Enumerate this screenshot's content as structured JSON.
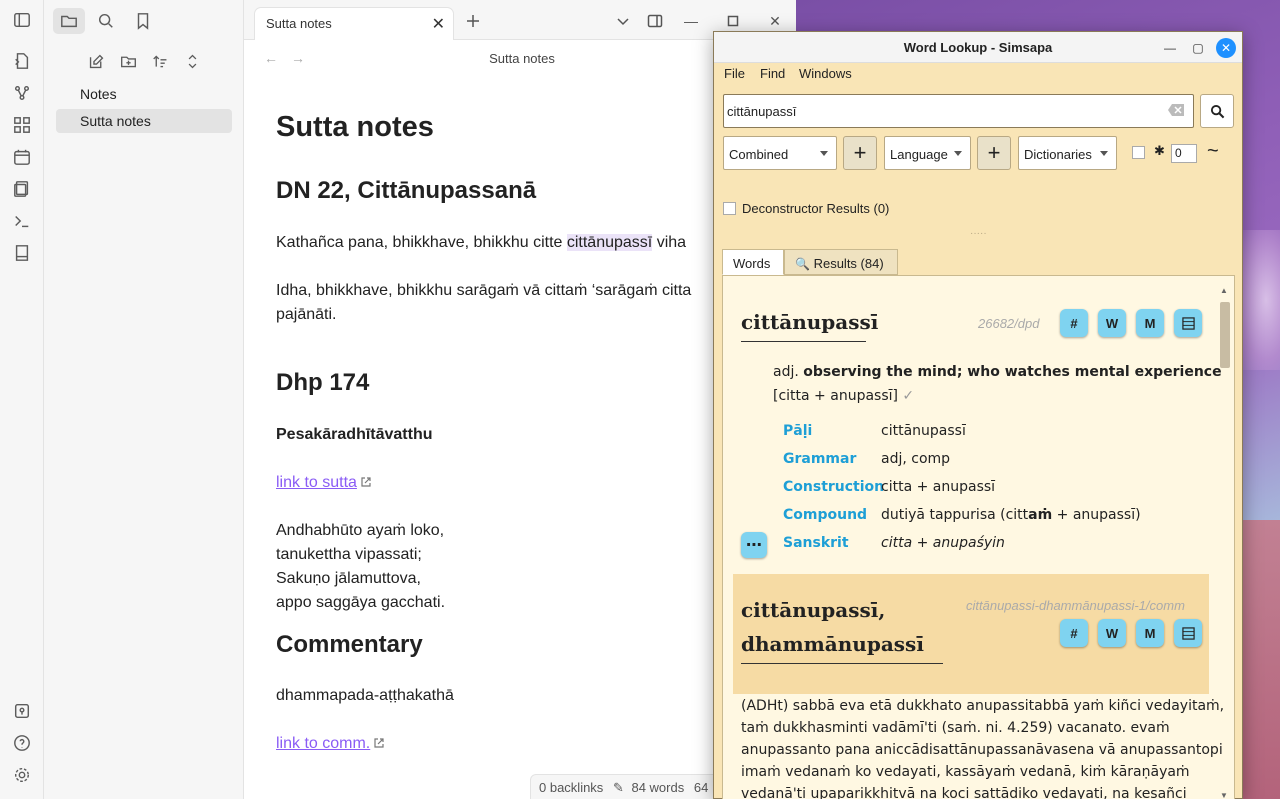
{
  "obsidian": {
    "tab_title": "Sutta notes",
    "view_title": "Sutta notes",
    "tree": [
      {
        "label": "Notes"
      },
      {
        "label": "Sutta notes"
      }
    ],
    "note": {
      "h1": "Sutta notes",
      "h2_1": "DN 22, Cittānupassanā",
      "p1_before": "Kathañca pana, bhikkhave, bhikkhu citte ",
      "p1_highlight": "cittānupassī",
      "p1_after": " viha",
      "p2_line1": "Idha, bhikkhave, bhikkhu sarāgaṁ vā cittaṁ ‘sarāgaṁ citta",
      "p2_line2": "pajānāti.",
      "h2_2": "Dhp 174",
      "bold_line": "Pesakāradhītāvatthu",
      "link1": "link to sutta",
      "verse": [
        "Andhabhūto ayaṁ loko,",
        "tanukettha vipassati;",
        "Sakuṇo jālamuttova,",
        "appo saggāya gacchati."
      ],
      "h2_3": "Commentary",
      "comm_text": "dhammapada-aṭṭhakathā",
      "link2": "link to comm."
    },
    "status": {
      "backlinks": "0 backlinks",
      "words": "84 words",
      "chars": "64"
    }
  },
  "simsapa": {
    "window_title": "Word Lookup - Simsapa",
    "menu": [
      "File",
      "Find",
      "Windows"
    ],
    "search_value": "cittānupassī",
    "combined_select": "Combined",
    "language_select": "Language",
    "dictionaries_select": "Dictionaries",
    "spin_value": "0",
    "deconstructor": "Deconstructor Results (0)",
    "tabs": {
      "words": "Words",
      "results": "Results (84)"
    },
    "entry1": {
      "head": "cittānupassī",
      "uid": "26682/dpd",
      "pos": "adj.",
      "meaning": "observing the mind; who watches mental experience",
      "construction_inline": "[citta + anupassī]",
      "check": "✓",
      "grammar": [
        {
          "label": "Pāḷi",
          "value": "cittānupassī"
        },
        {
          "label": "Grammar",
          "value": "adj, comp"
        },
        {
          "label": "Construction",
          "value": "citta + anupassī"
        },
        {
          "label": "Compound",
          "value_pre": "dutiyā tappurisa (citt",
          "value_bold": "aṁ",
          "value_post": " + anupassī)"
        },
        {
          "label": "Sanskrit",
          "value": "citta + anupaśyin"
        }
      ],
      "buttons": [
        "#",
        "W",
        "M"
      ]
    },
    "entry2": {
      "head_line1": "cittānupassī,",
      "head_line2": "dhammānupassī",
      "uid": "cittānupassi-dhammānupassi-1/comm",
      "text": [
        "(ADHt) sabbā eva etā dukkhato anupassitabbā yaṁ kiñci vedayitaṁ,",
        "taṁ dukkhasminti vadāmī'ti (saṁ. ni. 4.259) vacanato. evaṁ",
        "anupassanto pana aniccādisattānupassanāvasena vā anupassantopi",
        "imaṁ vedanaṁ ko vedayati, kassāyaṁ vedanā, kiṁ kāraṇāyaṁ",
        "vedanā'ti upaparikkhitvā na koci sattādiko vedayati, na kesañci"
      ]
    }
  },
  "colors": {
    "accent_link": "#8a5cf5",
    "simsapa_bg": "#f9e5b6",
    "grammar_label": "#1e9fd6",
    "icon_button": "#7fd3f0",
    "close_button": "#1e90ff"
  }
}
